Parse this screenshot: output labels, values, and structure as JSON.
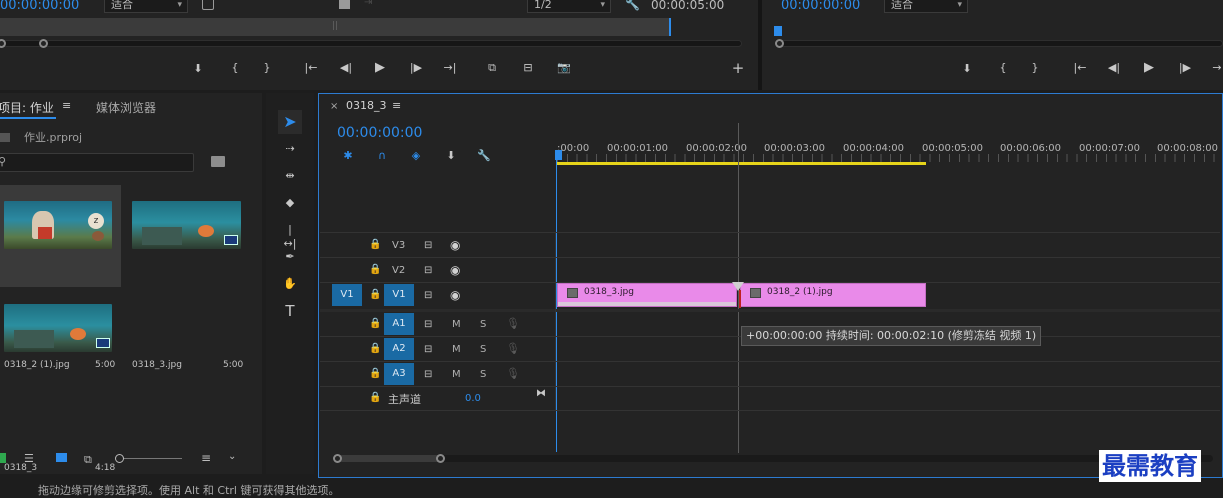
{
  "source_monitor": {
    "timecode": "00:00:00:00",
    "fit_label": "适合"
  },
  "program_monitor_left": {
    "resolution": "1/2",
    "duration": "00:00:05:00"
  },
  "program_monitor": {
    "timecode": "00:00:00:00",
    "fit_label": "适合"
  },
  "project_panel": {
    "tab_project": "项目: 作业",
    "tab_media": "媒体浏览器",
    "project_file": "作业.prproj",
    "items": [
      {
        "name": "0318_2 (1).jpg",
        "duration": "5:00"
      },
      {
        "name": "0318_3.jpg",
        "duration": "5:00"
      },
      {
        "name": "0318_3",
        "duration": "4:18"
      }
    ]
  },
  "timeline": {
    "sequence_name": "0318_3",
    "timecode": "00:00:00:00",
    "ruler": [
      ":00:00",
      "00:00:01:00",
      "00:00:02:00",
      "00:00:03:00",
      "00:00:04:00",
      "00:00:05:00",
      "00:00:06:00",
      "00:00:07:00",
      "00:00:08:00"
    ],
    "video_tracks": [
      {
        "name": "V3",
        "source": ""
      },
      {
        "name": "V2",
        "source": ""
      },
      {
        "name": "V1",
        "source": "V1"
      }
    ],
    "audio_tracks": [
      {
        "name": "A1",
        "m": "M",
        "s": "S"
      },
      {
        "name": "A2",
        "m": "M",
        "s": "S"
      },
      {
        "name": "A3",
        "m": "M",
        "s": "S"
      }
    ],
    "master": {
      "label": "主声道",
      "value": "0.0"
    },
    "clips": [
      {
        "name": "0318_3.jpg"
      },
      {
        "name": "0318_2 (1).jpg"
      }
    ],
    "tooltip": "+00:00:00:00 持续时间: 00:00:02:10 (修剪冻结 视频 1)"
  },
  "status_bar": "拖动边缘可修剪选择项。使用 Alt 和 Ctrl 键可获得其他选项。",
  "watermark": "最需教育",
  "colors": {
    "accent": "#2d8ceb",
    "clip": "#e98ae9",
    "work_area": "#e6d41a",
    "track_selected": "#1a6aa4"
  }
}
